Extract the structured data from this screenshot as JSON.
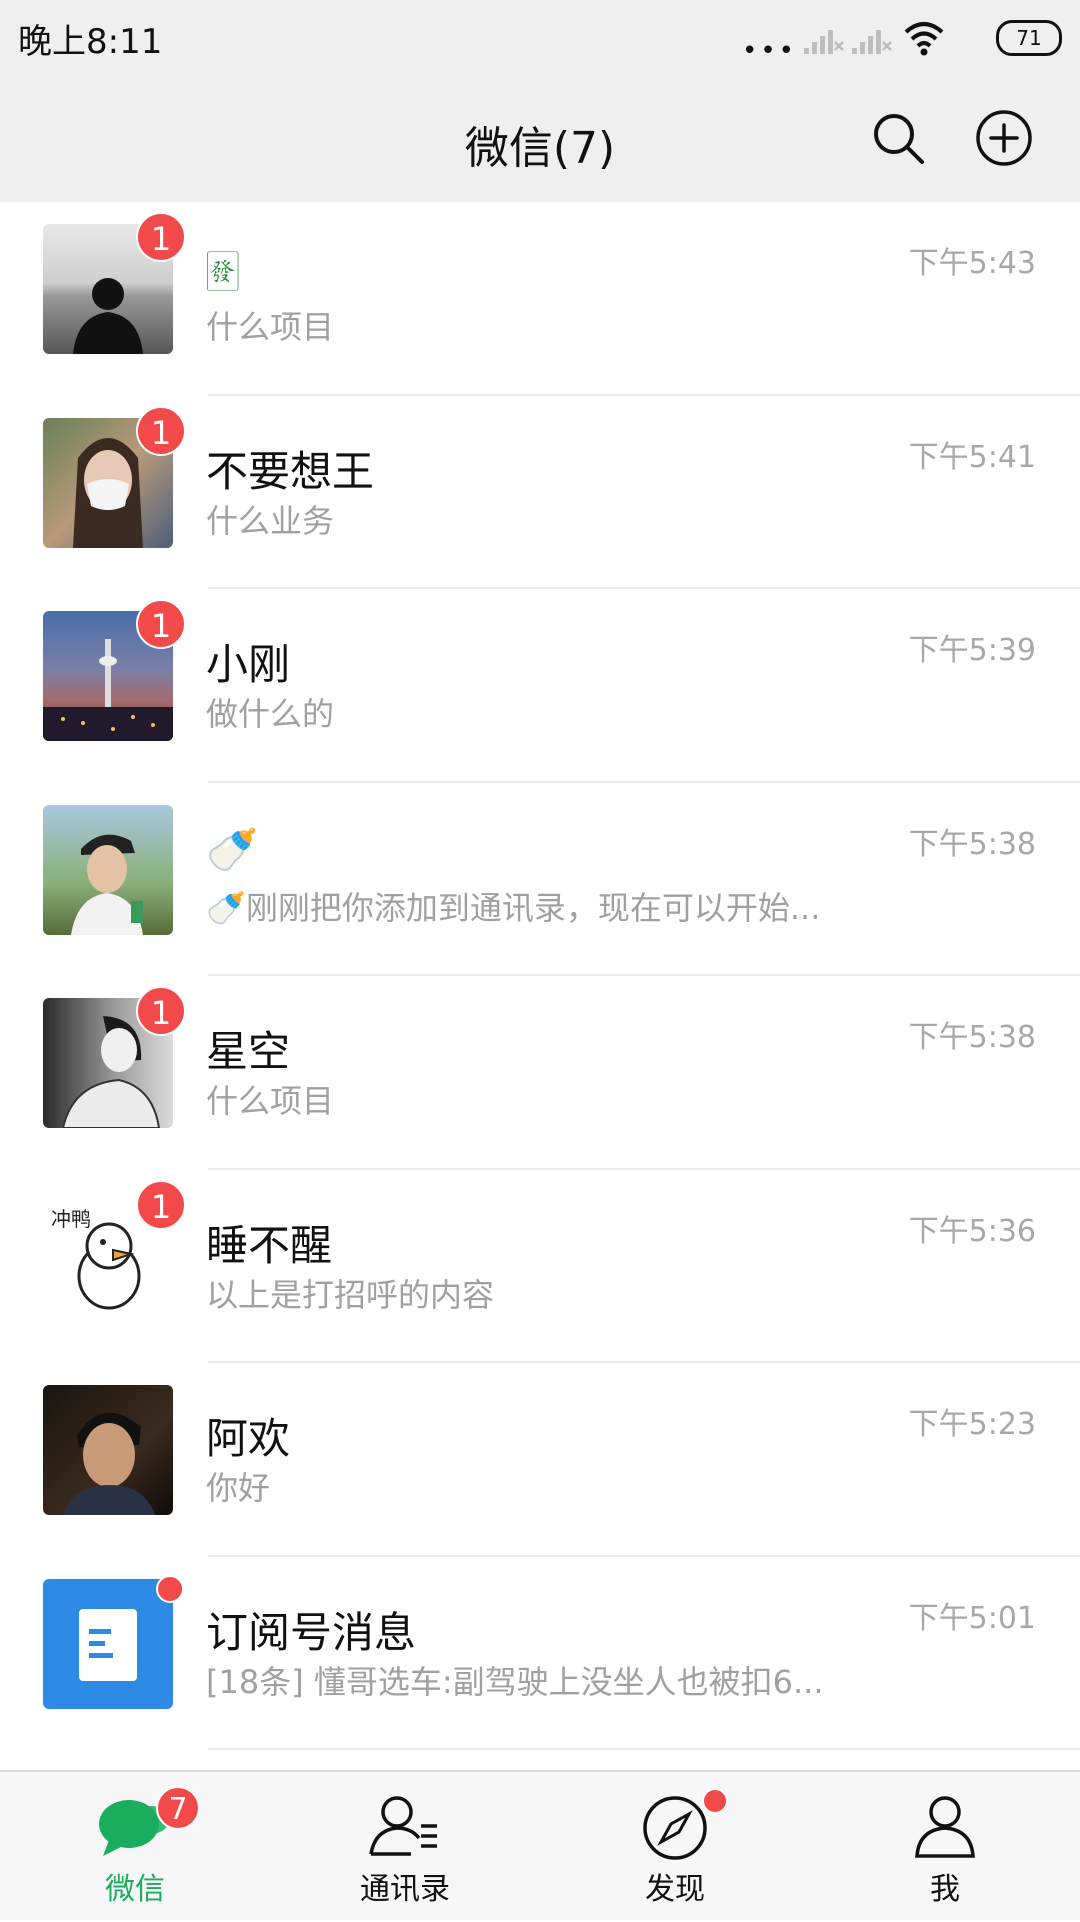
{
  "status_bar": {
    "time": "晚上8:11",
    "battery": "71"
  },
  "header": {
    "title": "微信(7)"
  },
  "chats": [
    {
      "name": "🀅",
      "preview": "什么项目",
      "time": "下午5:43",
      "unread": "1"
    },
    {
      "name": "不要想王",
      "preview": "什么业务",
      "time": "下午5:41",
      "unread": "1"
    },
    {
      "name": "小刚",
      "preview": "做什么的",
      "time": "下午5:39",
      "unread": "1"
    },
    {
      "name": "🍼",
      "preview": "🍼刚刚把你添加到通讯录，现在可以开始...",
      "time": "下午5:38",
      "unread": ""
    },
    {
      "name": "星空",
      "preview": "什么项目",
      "time": "下午5:38",
      "unread": "1"
    },
    {
      "name": "睡不醒",
      "preview": "以上是打招呼的内容",
      "time": "下午5:36",
      "unread": "1"
    },
    {
      "name": "阿欢",
      "preview": "你好",
      "time": "下午5:23",
      "unread": ""
    },
    {
      "name": "订阅号消息",
      "preview": "[18条] 懂哥选车:副驾驶上没坐人也被扣6...",
      "time": "下午5:01",
      "unread_dot": true
    }
  ],
  "tabs": [
    {
      "label": "微信",
      "badge": "7",
      "icon": "chat-bubbles-icon",
      "active": true
    },
    {
      "label": "通讯录",
      "icon": "contacts-icon"
    },
    {
      "label": "发现",
      "icon": "compass-icon",
      "dot": true
    },
    {
      "label": "我",
      "icon": "person-icon"
    }
  ],
  "colors": {
    "accent": "#1aad5e",
    "badge": "#f24a4a",
    "header_bg": "#efefef"
  }
}
